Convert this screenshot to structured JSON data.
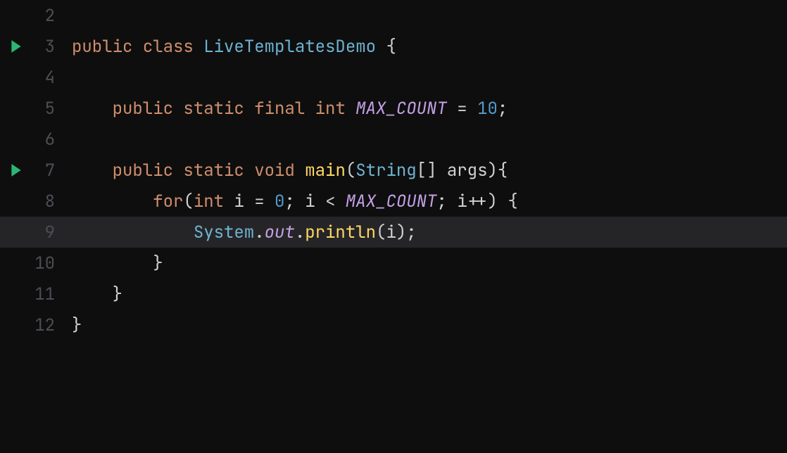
{
  "editor": {
    "highlightedLine": 9,
    "runIconLines": [
      3,
      7
    ],
    "colors": {
      "background": "#0e0e0e",
      "highlight": "#252527",
      "gutterText": "#4b4e54",
      "defaultText": "#cfd0d2",
      "keyword": "#cf8e6d",
      "type": "#6fb3d2",
      "method": "#ffd866",
      "italicField": "#c4a0e6",
      "number": "#529bd0",
      "runIcon": "#2bb673"
    },
    "lines": [
      {
        "num": 2,
        "indent": 0,
        "tokens": []
      },
      {
        "num": 3,
        "indent": 0,
        "tokens": [
          {
            "t": "kw",
            "v": "public"
          },
          {
            "t": "sp",
            "v": " "
          },
          {
            "t": "kw",
            "v": "class"
          },
          {
            "t": "sp",
            "v": " "
          },
          {
            "t": "classname",
            "v": "LiveTemplatesDemo"
          },
          {
            "t": "sp",
            "v": " "
          },
          {
            "t": "punct",
            "v": "{"
          }
        ]
      },
      {
        "num": 4,
        "indent": 0,
        "tokens": []
      },
      {
        "num": 5,
        "indent": 1,
        "tokens": [
          {
            "t": "kw",
            "v": "public"
          },
          {
            "t": "sp",
            "v": " "
          },
          {
            "t": "kw",
            "v": "static"
          },
          {
            "t": "sp",
            "v": " "
          },
          {
            "t": "kw",
            "v": "final"
          },
          {
            "t": "sp",
            "v": " "
          },
          {
            "t": "kw",
            "v": "int"
          },
          {
            "t": "sp",
            "v": " "
          },
          {
            "t": "field-it",
            "v": "MAX_COUNT"
          },
          {
            "t": "sp",
            "v": " "
          },
          {
            "t": "op",
            "v": "="
          },
          {
            "t": "sp",
            "v": " "
          },
          {
            "t": "num",
            "v": "10"
          },
          {
            "t": "punct",
            "v": ";"
          }
        ]
      },
      {
        "num": 6,
        "indent": 0,
        "tokens": []
      },
      {
        "num": 7,
        "indent": 1,
        "tokens": [
          {
            "t": "kw",
            "v": "public"
          },
          {
            "t": "sp",
            "v": " "
          },
          {
            "t": "kw",
            "v": "static"
          },
          {
            "t": "sp",
            "v": " "
          },
          {
            "t": "kw",
            "v": "void"
          },
          {
            "t": "sp",
            "v": " "
          },
          {
            "t": "method",
            "v": "main"
          },
          {
            "t": "punct",
            "v": "("
          },
          {
            "t": "type",
            "v": "String"
          },
          {
            "t": "punct",
            "v": "[] "
          },
          {
            "t": "param",
            "v": "args"
          },
          {
            "t": "punct",
            "v": "){"
          }
        ]
      },
      {
        "num": 8,
        "indent": 2,
        "tokens": [
          {
            "t": "kw",
            "v": "for"
          },
          {
            "t": "punct",
            "v": "("
          },
          {
            "t": "kw",
            "v": "int"
          },
          {
            "t": "sp",
            "v": " "
          },
          {
            "t": "param",
            "v": "i"
          },
          {
            "t": "sp",
            "v": " "
          },
          {
            "t": "op",
            "v": "="
          },
          {
            "t": "sp",
            "v": " "
          },
          {
            "t": "num",
            "v": "0"
          },
          {
            "t": "punct",
            "v": "; "
          },
          {
            "t": "param",
            "v": "i"
          },
          {
            "t": "sp",
            "v": " "
          },
          {
            "t": "op",
            "v": "<"
          },
          {
            "t": "sp",
            "v": " "
          },
          {
            "t": "field-it",
            "v": "MAX_COUNT"
          },
          {
            "t": "punct",
            "v": "; "
          },
          {
            "t": "param",
            "v": "i"
          },
          {
            "t": "op",
            "v": "++"
          },
          {
            "t": "punct",
            "v": ") {"
          }
        ]
      },
      {
        "num": 9,
        "indent": 3,
        "tokens": [
          {
            "t": "classname",
            "v": "System"
          },
          {
            "t": "punct",
            "v": "."
          },
          {
            "t": "field-it",
            "v": "out"
          },
          {
            "t": "punct",
            "v": "."
          },
          {
            "t": "method",
            "v": "println"
          },
          {
            "t": "punct",
            "v": "("
          },
          {
            "t": "param",
            "v": "i"
          },
          {
            "t": "punct",
            "v": ");"
          }
        ]
      },
      {
        "num": 10,
        "indent": 2,
        "tokens": [
          {
            "t": "punct",
            "v": "}"
          }
        ]
      },
      {
        "num": 11,
        "indent": 1,
        "tokens": [
          {
            "t": "punct",
            "v": "}"
          }
        ]
      },
      {
        "num": 12,
        "indent": 0,
        "tokens": [
          {
            "t": "punct",
            "v": "}"
          }
        ]
      }
    ]
  }
}
